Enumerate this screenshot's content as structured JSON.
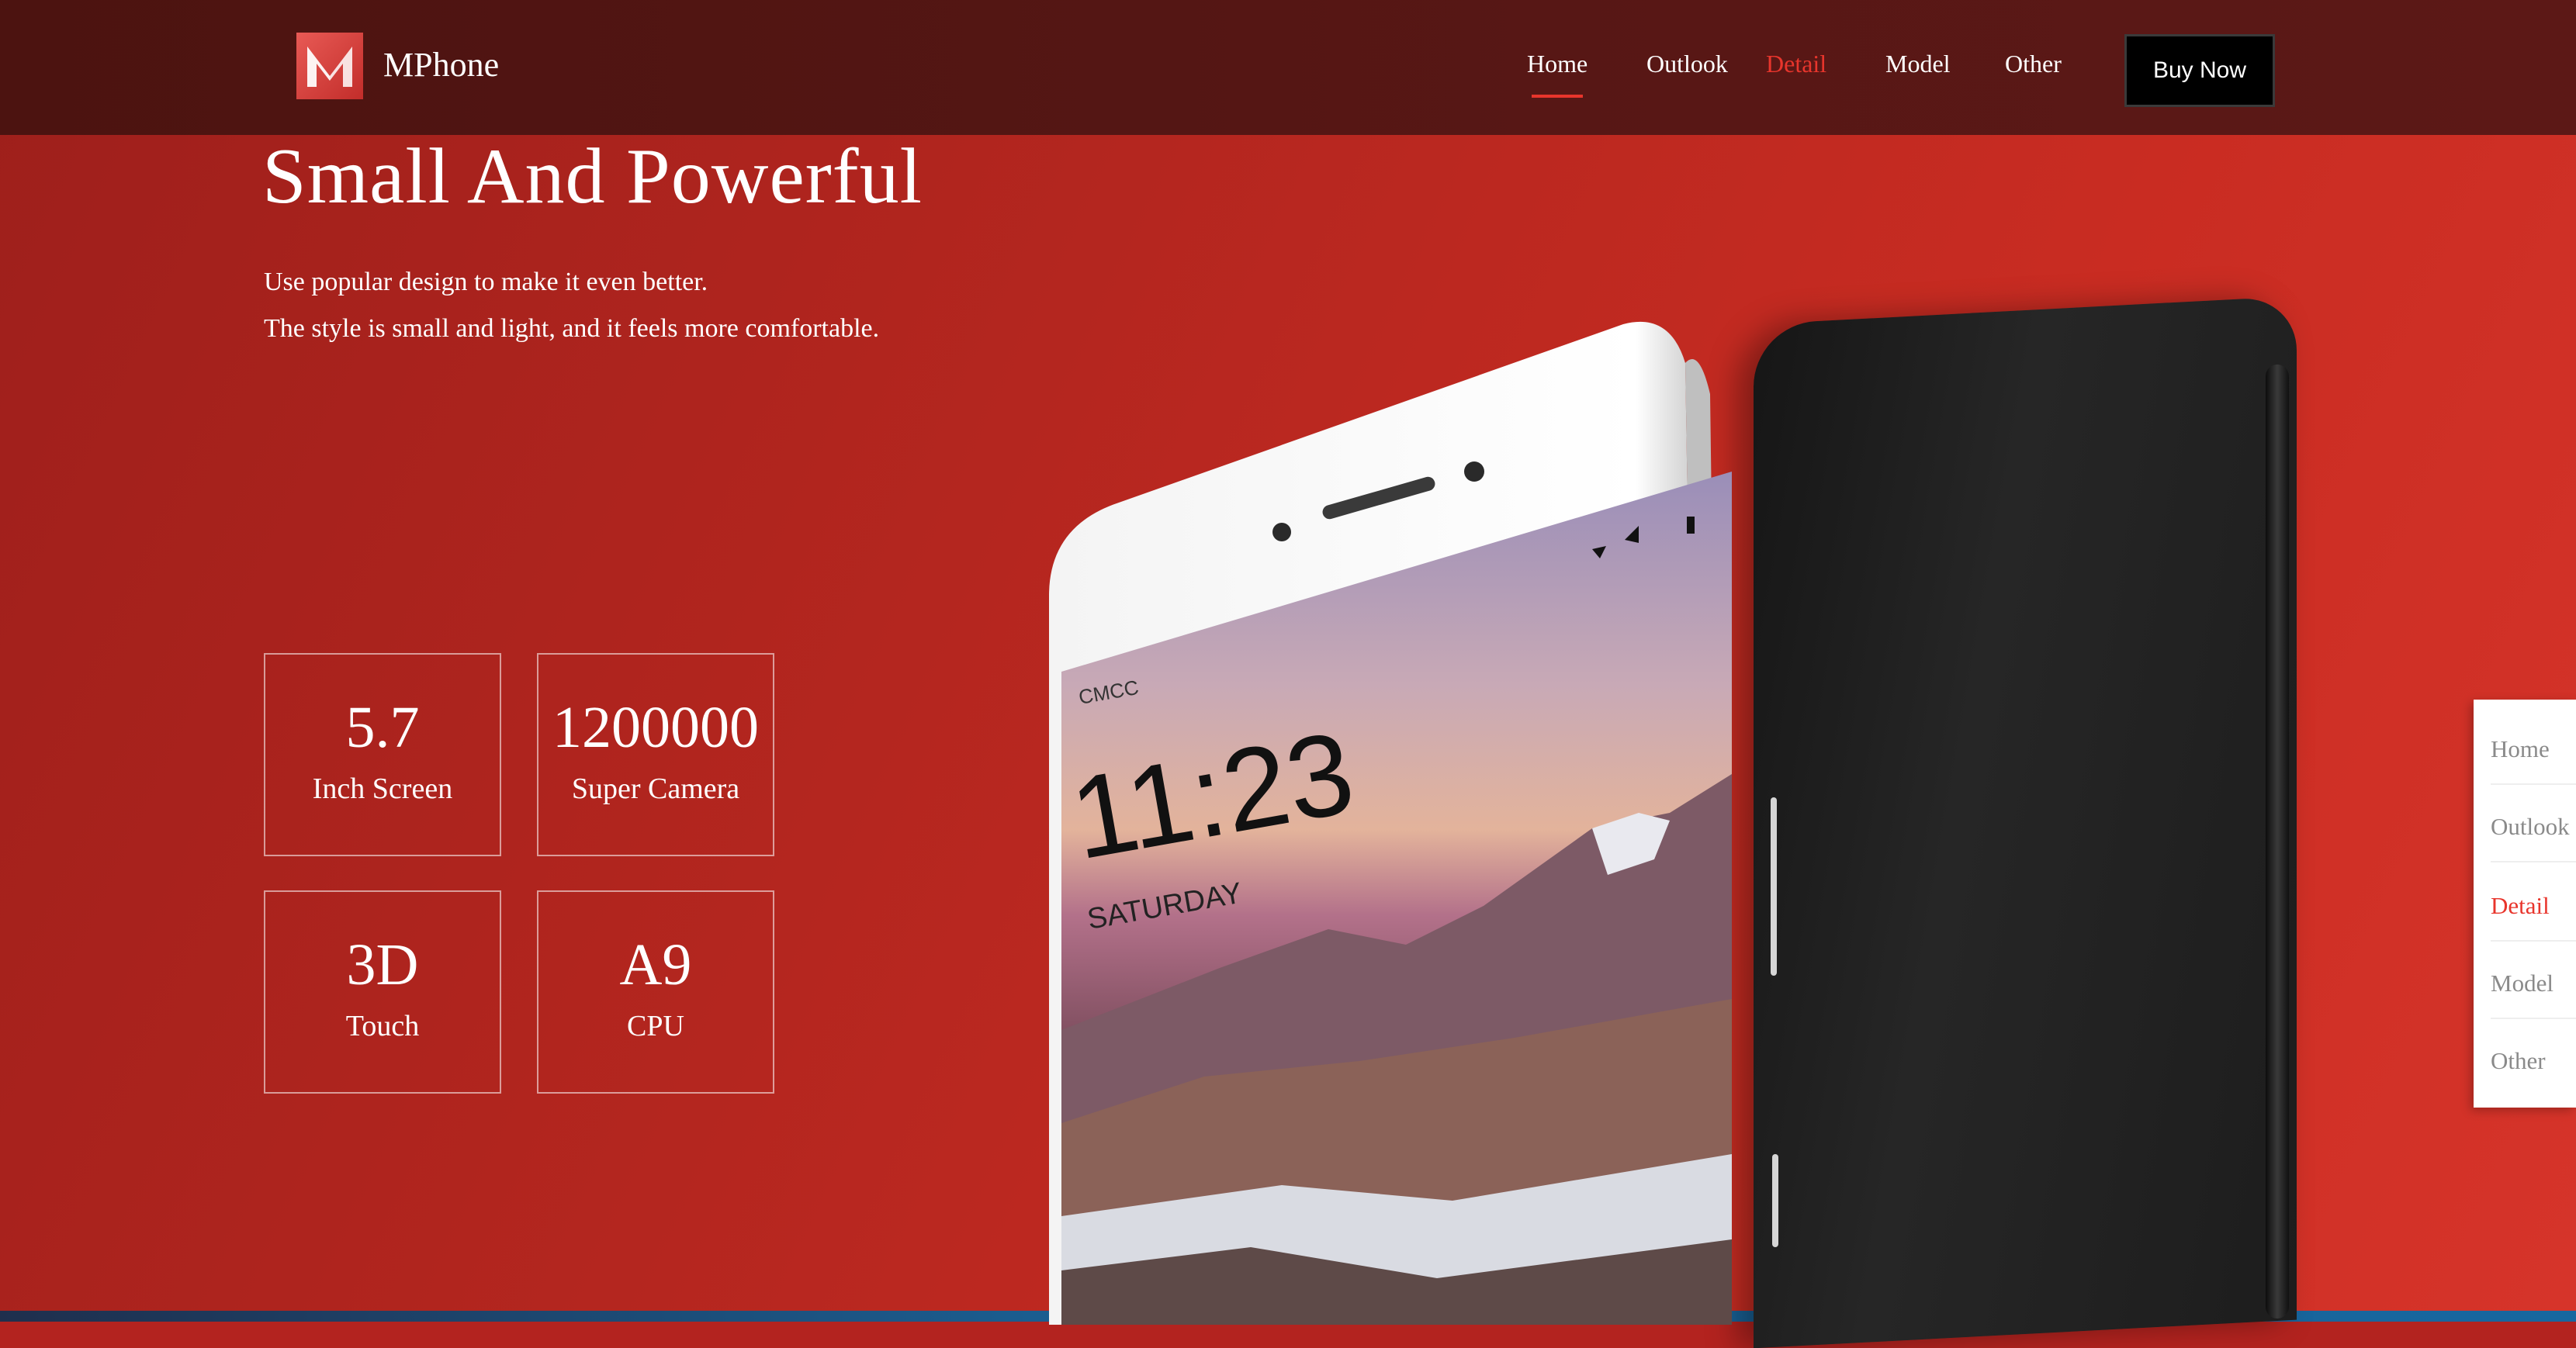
{
  "header": {
    "brand": "MPhone",
    "nav": [
      "Home",
      "Outlook",
      "Detail",
      "Model",
      "Other"
    ],
    "buy_label": "Buy Now"
  },
  "hero": {
    "headline": "Small And Powerful",
    "taglines": [
      "Use popular design to make it even better.",
      "The style is small and light, and it feels more comfortable."
    ],
    "features": [
      {
        "value": "5.7",
        "label": "Inch Screen"
      },
      {
        "value": "1200000",
        "label": "Super Camera"
      },
      {
        "value": "3D",
        "label": "Touch"
      },
      {
        "value": "A9",
        "label": "CPU"
      }
    ]
  },
  "phone": {
    "carrier": "CMCC",
    "time": "11:23",
    "day": "SATURDAY"
  },
  "side_nav": [
    "Home",
    "Outlook",
    "Detail",
    "Model",
    "Other"
  ],
  "colors": {
    "accent": "#e8352c",
    "header": "#541614",
    "hero": "#b4261f"
  }
}
